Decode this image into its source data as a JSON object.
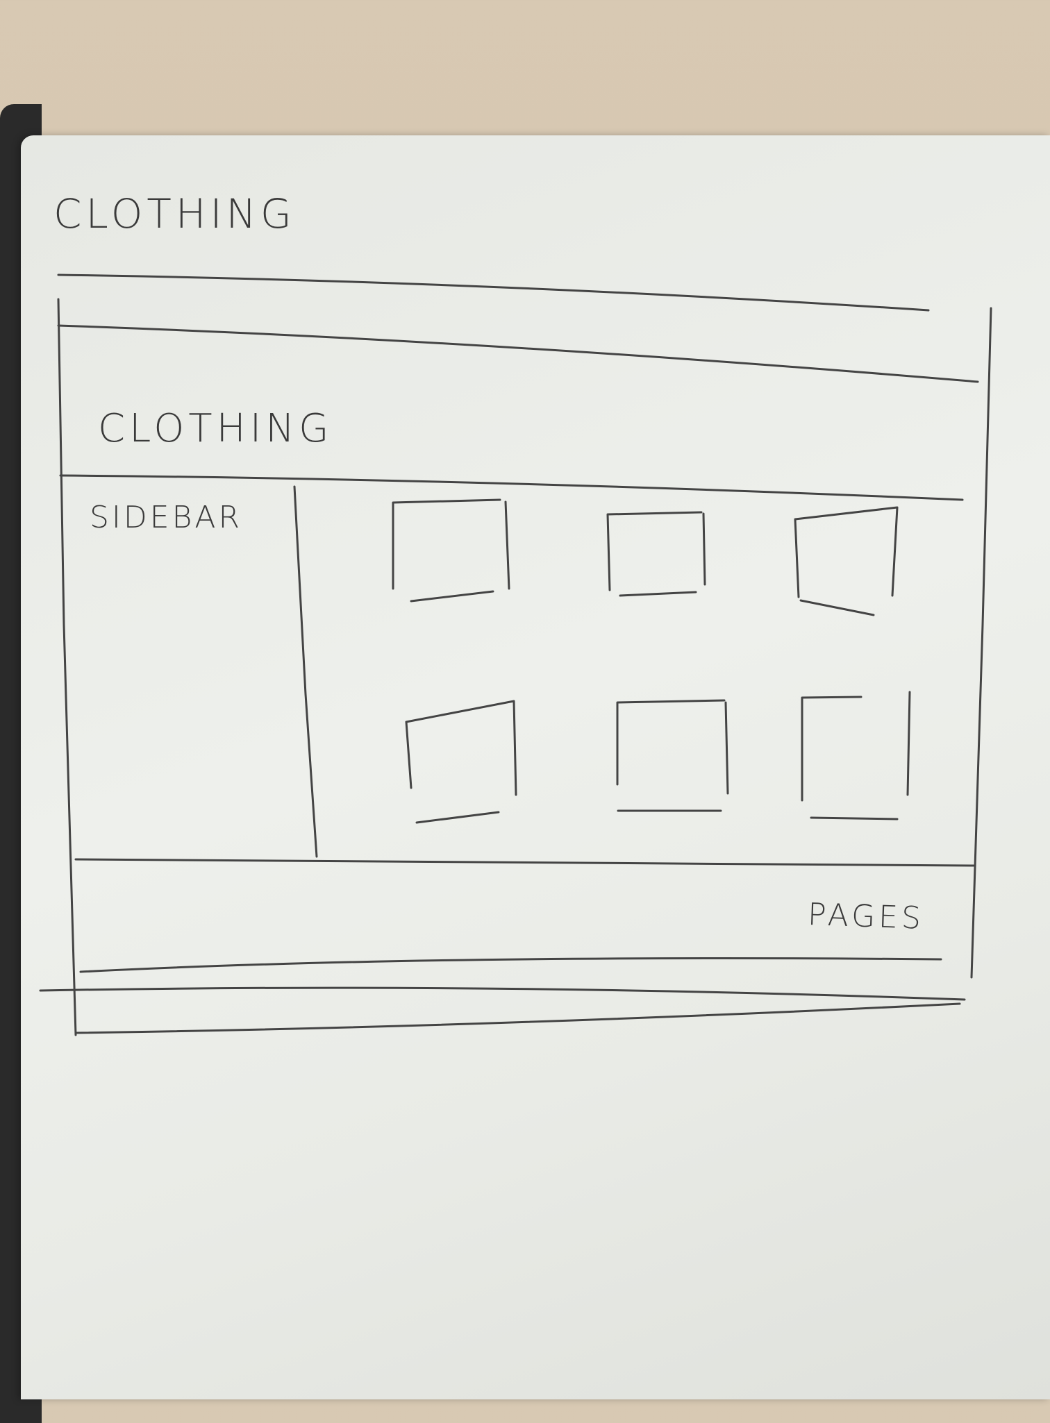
{
  "page_title": "CLOTHING",
  "wireframe": {
    "header_title": "CLOTHING",
    "sidebar_label": "SIDEBAR",
    "product_grid": {
      "rows": 2,
      "columns": 3
    },
    "footer_label": "PAGES"
  },
  "colors": {
    "ink": "#3a3a3a",
    "paper": "#eceee9",
    "desk": "#d8c9b3"
  }
}
